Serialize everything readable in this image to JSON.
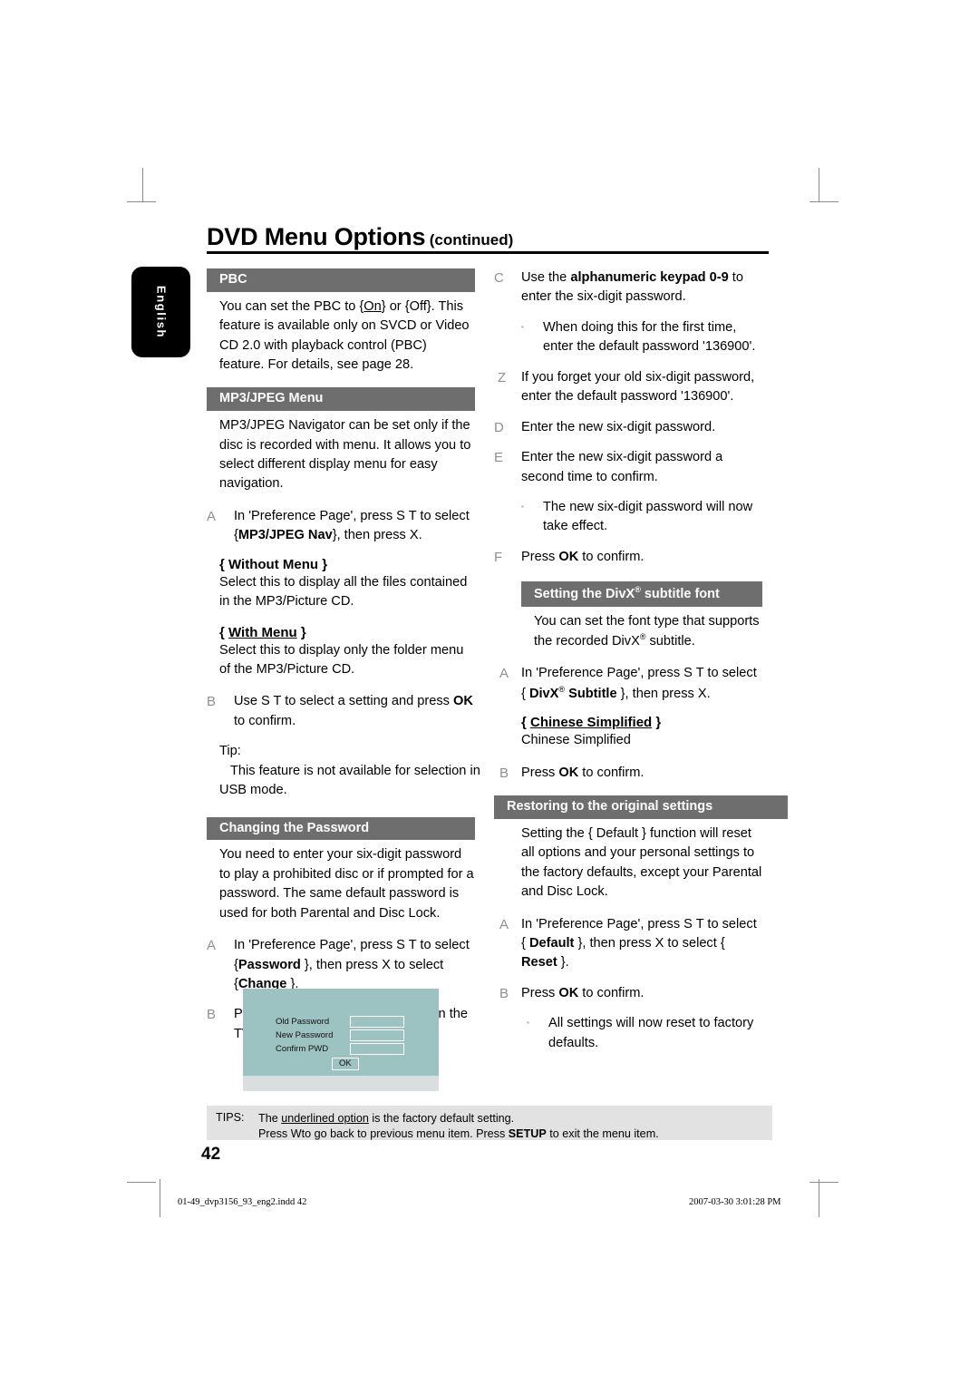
{
  "page": {
    "title": "DVD Menu Options",
    "title_suffix": "(continued)",
    "language_tab": "English",
    "page_number": "42"
  },
  "left_column": {
    "pbc": {
      "heading": "PBC",
      "body_1": "You can set the PBC to {",
      "body_default": "On",
      "body_2": "} or {Off}. This feature is available only on SVCD or Video CD 2.0 with playback control (PBC) feature. For details, see page 28."
    },
    "mp3jpeg": {
      "heading": "MP3/JPEG Menu",
      "body": "MP3/JPEG Navigator can be set only if the disc is recorded with menu. It allows you to select different display menu for easy navigation.",
      "step_a_marker": "A",
      "step_a_part1": "In 'Preference Page', press  S  T to select {",
      "step_a_bold": "MP3/JPEG Nav",
      "step_a_part2": "}, then press  X.",
      "opt1_title_open": "{ ",
      "opt1_title": "Without Menu",
      "opt1_title_close": " }",
      "opt1_body": "Select this to display all the files contained in the MP3/Picture CD.",
      "opt2_title": "With Menu",
      "opt2_body": "Select this to display only the folder menu of the MP3/Picture CD.",
      "step_b_marker": "B",
      "step_b_part1": "Use  S  T to select a setting and press ",
      "step_b_bold": "OK",
      "step_b_part2": " to confirm."
    },
    "tip": {
      "label": "Tip:",
      "line1": "This feature is not available for selection in",
      "line2": "USB mode."
    },
    "password": {
      "heading": "Changing the Password",
      "body": "You need to enter your six-digit password to play a prohibited disc or if prompted for a password. The same default password is used for both Parental and Disc Lock.",
      "step_a_marker": "A",
      "step_a_part1": "In 'Preference Page', press  S  T to select {",
      "step_a_bold1": "Password",
      "step_a_part2": " }, then press  X to select {",
      "step_a_bold2": "Change",
      "step_a_part3": " }.",
      "step_b_marker": "B",
      "step_b_part1": "Press ",
      "step_b_bold": "OK",
      "step_b_part2": " and the menu appears on the TV screen."
    }
  },
  "dialog": {
    "label_old": "Old  Password",
    "label_new": "New Password",
    "label_confirm": "Confirm PWD",
    "ok_button": "OK"
  },
  "right_column": {
    "password_steps": {
      "step_c_marker": "C",
      "step_c_part1": "Use the ",
      "step_c_bold": "alphanumeric keypad 0-9",
      "step_c_part2": " to enter the six-digit password.",
      "bullet_c": "When doing this for the first time, enter the default password '136900'.",
      "step_z_marker": "Z",
      "step_z": "If you forget your old six-digit password, enter the default password '136900'.",
      "step_d_marker": "D",
      "step_d": "Enter the new six-digit password.",
      "step_e_marker": "E",
      "step_e": "Enter the new six-digit password a second time to confirm.",
      "bullet_e": "The new six-digit password will now take effect.",
      "step_f_marker": "F",
      "step_f_part1": "Press ",
      "step_f_bold": "OK",
      "step_f_part2": " to confirm."
    },
    "divx": {
      "heading_1": "Setting the DivX",
      "heading_reg": "®",
      "heading_2": " subtitle font",
      "body_1": "You can set the font type that supports the recorded DivX",
      "body_reg": "®",
      "body_2": " subtitle.",
      "step_a_marker": "A",
      "step_a_part1": "In 'Preference Page', press  S  T to select { ",
      "step_a_bold": "DivX",
      "step_a_reg": "®",
      "step_a_bold2": " Subtitle",
      "step_a_part2": " }, then press  X.",
      "opt_title": "Chinese Simplified",
      "opt_body": "Chinese Simplified",
      "step_b_marker": "B",
      "step_b_part1": "Press ",
      "step_b_bold": "OK",
      "step_b_part2": " to confirm."
    },
    "restore": {
      "heading": "Restoring to the original settings",
      "body": "Setting the { Default } function will reset all options and your personal settings to the factory defaults, except your Parental and Disc Lock.",
      "step_a_marker": "A",
      "step_a_part1": "In 'Preference Page', press  S  T to select { ",
      "step_a_bold1": "Default",
      "step_a_part2": " }, then press  X to select { ",
      "step_a_bold2": "Reset",
      "step_a_part3": " }.",
      "step_b_marker": "B",
      "step_b_part1": "Press ",
      "step_b_bold": "OK",
      "step_b_part2": " to confirm.",
      "bullet_b": "All settings will now reset to factory defaults."
    }
  },
  "tips": {
    "label": "TIPS:",
    "line1_part1": "The ",
    "line1_underlined": "underlined option",
    "line1_part2": " is the factory default setting.",
    "line2_part1": "Press   Wto go back to previous menu item. Press ",
    "line2_bold": "SETUP",
    "line2_part2": " to exit the menu item."
  },
  "footer": {
    "file": "01-49_dvp3156_93_eng2.indd   42",
    "date": "2007-03-30   3:01:28 PM"
  }
}
